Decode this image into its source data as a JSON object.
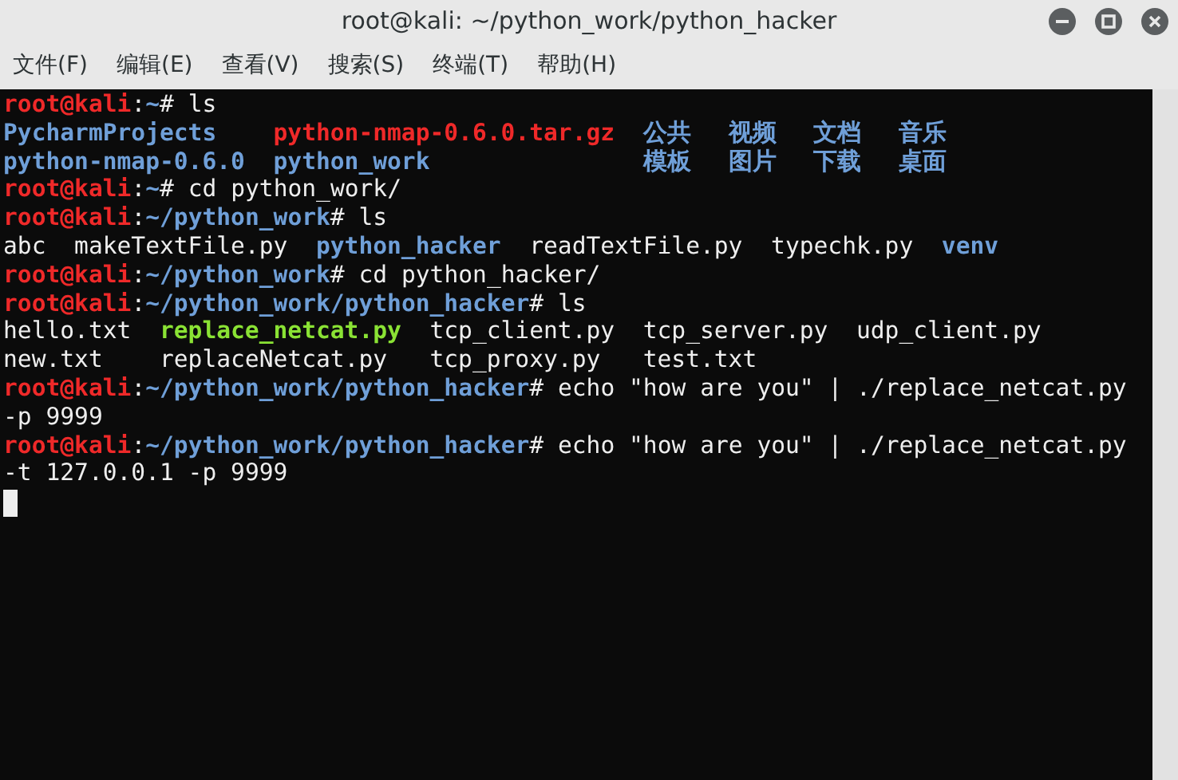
{
  "window": {
    "title": "root@kali: ~/python_work/python_hacker"
  },
  "menu": [
    "文件(F)",
    "编辑(E)",
    "查看(V)",
    "搜索(S)",
    "终端(T)",
    "帮助(H)"
  ],
  "terminal": {
    "blocks": [
      {
        "kind": "prompt",
        "user": "root@kali",
        "separator": ":",
        "path": "~",
        "symbol": "#",
        "command": "ls"
      },
      {
        "kind": "listing",
        "rows": [
          [
            {
              "text": "PycharmProjects",
              "kind": "dir"
            },
            {
              "text": "python-nmap-0.6.0.tar.gz",
              "kind": "archive"
            },
            {
              "text": "公共",
              "kind": "dir"
            },
            {
              "text": "视频",
              "kind": "dir"
            },
            {
              "text": "文档",
              "kind": "dir"
            },
            {
              "text": "音乐",
              "kind": "dir"
            }
          ],
          [
            {
              "text": "python-nmap-0.6.0",
              "kind": "dir"
            },
            {
              "text": "python_work",
              "kind": "dir"
            },
            {
              "text": "模板",
              "kind": "dir"
            },
            {
              "text": "图片",
              "kind": "dir"
            },
            {
              "text": "下载",
              "kind": "dir"
            },
            {
              "text": "桌面",
              "kind": "dir"
            }
          ]
        ]
      },
      {
        "kind": "prompt",
        "user": "root@kali",
        "separator": ":",
        "path": "~",
        "symbol": "#",
        "command": "cd python_work/"
      },
      {
        "kind": "prompt",
        "user": "root@kali",
        "separator": ":",
        "path": "~/python_work",
        "symbol": "#",
        "command": "ls"
      },
      {
        "kind": "listing",
        "rows": [
          [
            {
              "text": "abc",
              "kind": "file"
            },
            {
              "text": "makeTextFile.py",
              "kind": "file"
            },
            {
              "text": "python_hacker",
              "kind": "dir"
            },
            {
              "text": "readTextFile.py",
              "kind": "file"
            },
            {
              "text": "typechk.py",
              "kind": "file"
            },
            {
              "text": "venv",
              "kind": "dir"
            }
          ]
        ]
      },
      {
        "kind": "prompt",
        "user": "root@kali",
        "separator": ":",
        "path": "~/python_work",
        "symbol": "#",
        "command": "cd python_hacker/"
      },
      {
        "kind": "prompt",
        "user": "root@kali",
        "separator": ":",
        "path": "~/python_work/python_hacker",
        "symbol": "#",
        "command": "ls"
      },
      {
        "kind": "listing",
        "rows": [
          [
            {
              "text": "hello.txt",
              "kind": "file"
            },
            {
              "text": "replace_netcat.py",
              "kind": "exec"
            },
            {
              "text": "tcp_client.py",
              "kind": "file"
            },
            {
              "text": "tcp_server.py",
              "kind": "file"
            },
            {
              "text": "udp_client.py",
              "kind": "file"
            }
          ],
          [
            {
              "text": "new.txt",
              "kind": "file"
            },
            {
              "text": "replaceNetcat.py",
              "kind": "file"
            },
            {
              "text": "tcp_proxy.py",
              "kind": "file"
            },
            {
              "text": "test.txt",
              "kind": "file"
            }
          ]
        ]
      },
      {
        "kind": "prompt",
        "user": "root@kali",
        "separator": ":",
        "path": "~/python_work/python_hacker",
        "symbol": "#",
        "command": "echo \"how are you\" | ./replace_netcat.py",
        "continuation": "-p 9999"
      },
      {
        "kind": "prompt",
        "user": "root@kali",
        "separator": ":",
        "path": "~/python_work/python_hacker",
        "symbol": "#",
        "command": "echo \"how are you\" | ./replace_netcat.py",
        "continuation": "-t 127.0.0.1 -p 9999"
      },
      {
        "kind": "cursor"
      }
    ]
  }
}
